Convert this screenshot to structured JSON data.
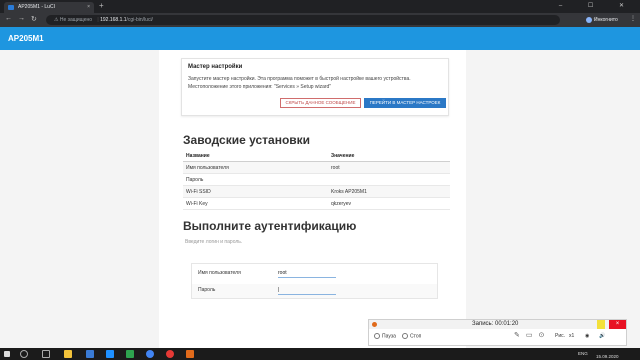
{
  "browser": {
    "tab_title": "AP205M1 - LuCI",
    "tab_close": "×",
    "new_tab": "+",
    "insecure_label": "Не защищено",
    "url_host": "192.168.1.1",
    "url_path": "/cgi-bin/luci/",
    "profile": "Инкогнито",
    "window_controls": "– ☐ ✕"
  },
  "header": {
    "brand": "AP205M1",
    "subtitle": ""
  },
  "wizard_card": {
    "title": "Мастер настройки",
    "line1": "Запустите мастер настройки. Эта программа поможет в быстрой настройке вашего устройства.",
    "line2": "Местоположение этого приложения: \"Services » Setup wizard\"",
    "hide_button": "СКРЫТЬ ДАННОЕ СООБЩЕНИЕ",
    "open_button": "ПЕРЕЙТИ В МАСТЕР НАСТРОЕК"
  },
  "factory": {
    "heading": "Заводские установки",
    "columns": [
      "Название",
      "Значение"
    ],
    "rows": [
      [
        "Имя пользователя",
        "root"
      ],
      [
        "Пароль",
        ""
      ],
      [
        "Wi-Fi SSID",
        "Kroks AP205M1"
      ],
      [
        "Wi-Fi Key",
        "qkzeryev"
      ]
    ]
  },
  "auth": {
    "heading": "Выполните аутентификацию",
    "hint": "Введите логин и пароль.",
    "username_label": "Имя пользователя",
    "username_value": "root",
    "password_label": "Пароль",
    "password_value": "|"
  },
  "recorder": {
    "time_label": "Запись: 00:01:20",
    "pause": "Пауза",
    "stop": "Стоп",
    "rec_label": "Рис.",
    "zoom": "x1",
    "close": "×"
  },
  "taskbar": {
    "lang": "ENG",
    "date": "15.09.2020"
  },
  "colors": {
    "luci_blue": "#1e96e0",
    "wizard_btn": "#2b78c6",
    "hide_btn": "#c04a4a"
  }
}
